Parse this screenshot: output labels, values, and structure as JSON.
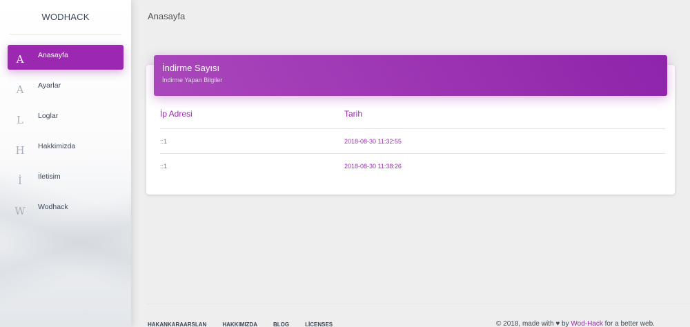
{
  "sidebar": {
    "brand": "WODHACK",
    "items": [
      {
        "icon": "A",
        "label": "Anasayfa"
      },
      {
        "icon": "A",
        "label": "Ayarlar"
      },
      {
        "icon": "L",
        "label": "Loglar"
      },
      {
        "icon": "H",
        "label": "Hakkimizda"
      },
      {
        "icon": "İ",
        "label": "İletisim"
      },
      {
        "icon": "W",
        "label": "Wodhack"
      }
    ]
  },
  "topbar": {
    "title": "Anasayfa"
  },
  "card": {
    "title": "İndirme Sayısı",
    "subtitle": "İndirme Yapan Bilgiler",
    "columns": [
      "İp Adresi",
      "Tarih"
    ],
    "rows": [
      {
        "ip": "::1",
        "date": "2018-08-30 11:32:55"
      },
      {
        "ip": "::1",
        "date": "2018-08-30 11:38:26"
      }
    ]
  },
  "footer": {
    "links": [
      "HAKANKARAARSLAN",
      "HAKKIMIZDA",
      "BLOG",
      "LİCENSES"
    ],
    "copyright_prefix": "© 2018, made with",
    "copyright_by": "by",
    "copyright_brand": "Wod-Hack",
    "copyright_suffix": "for a better web."
  },
  "colors": {
    "accent": "#9c27b0",
    "background": "#eeeeee"
  }
}
